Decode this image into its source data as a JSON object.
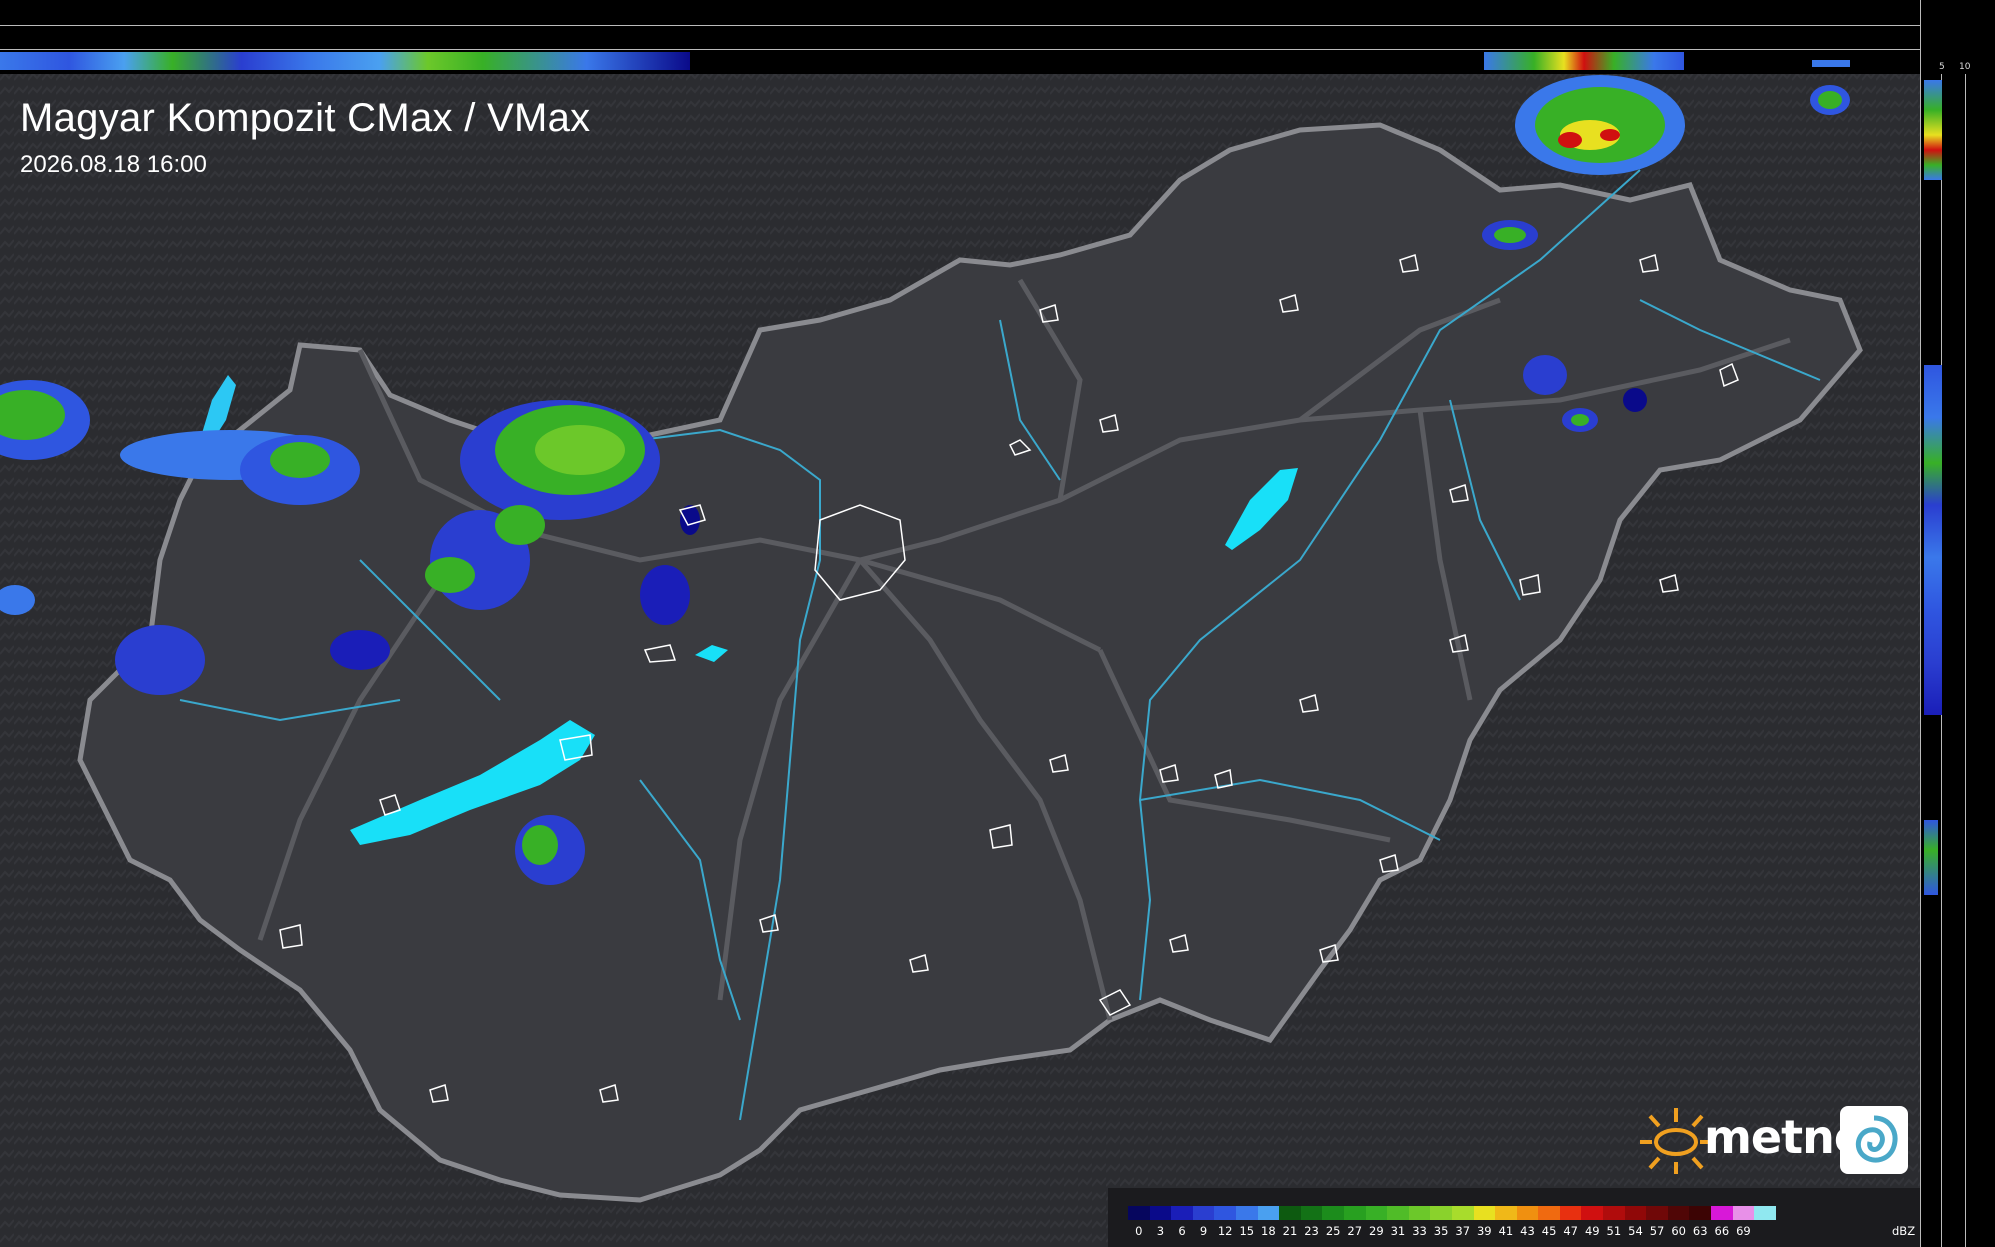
{
  "map": {
    "title": "Magyar Kompozit CMax / VMax",
    "timestamp": "2026.08.18 16:00",
    "vertical_profile_ticks": [
      "10",
      "5"
    ],
    "horizontal_profile_ticks": [
      "5",
      "10"
    ]
  },
  "legend": {
    "unit": "dBZ",
    "steps": [
      {
        "value": "0",
        "color": "#06065e"
      },
      {
        "value": "3",
        "color": "#0a0a8a"
      },
      {
        "value": "6",
        "color": "#1a1eb8"
      },
      {
        "value": "9",
        "color": "#2a3ed0"
      },
      {
        "value": "12",
        "color": "#2f56e0"
      },
      {
        "value": "15",
        "color": "#3a78ea"
      },
      {
        "value": "18",
        "color": "#4aa0f0"
      },
      {
        "value": "21",
        "color": "#0d5a10"
      },
      {
        "value": "23",
        "color": "#137216"
      },
      {
        "value": "25",
        "color": "#1c8c1c"
      },
      {
        "value": "27",
        "color": "#28a020"
      },
      {
        "value": "29",
        "color": "#38b026"
      },
      {
        "value": "31",
        "color": "#50bc28"
      },
      {
        "value": "33",
        "color": "#6cc82a"
      },
      {
        "value": "35",
        "color": "#8ad22c"
      },
      {
        "value": "37",
        "color": "#a8dc2c"
      },
      {
        "value": "39",
        "color": "#e8e020"
      },
      {
        "value": "41",
        "color": "#f0b818"
      },
      {
        "value": "43",
        "color": "#f09010"
      },
      {
        "value": "45",
        "color": "#f06a10"
      },
      {
        "value": "47",
        "color": "#e83010"
      },
      {
        "value": "49",
        "color": "#d01010"
      },
      {
        "value": "51",
        "color": "#b00c0c"
      },
      {
        "value": "54",
        "color": "#900808"
      },
      {
        "value": "57",
        "color": "#700808"
      },
      {
        "value": "60",
        "color": "#500606"
      },
      {
        "value": "63",
        "color": "#3c0404"
      },
      {
        "value": "66",
        "color": "#d818d8"
      },
      {
        "value": "69",
        "color": "#e890e8"
      },
      {
        "value": "",
        "color": "#90e8f0"
      }
    ]
  },
  "brand": {
    "name": "metnet",
    "sun_color": "#f0a020",
    "logo_swirl_color": "#4aa8c8"
  },
  "colors": {
    "background_terrain": "#2b2c30",
    "country_fill": "#3a3b40",
    "border": "#8a8b90",
    "roads": "#5a5b60",
    "rivers": "#3aa8cc",
    "lakes": "#18e0f8",
    "settlements": "#ffffff"
  }
}
